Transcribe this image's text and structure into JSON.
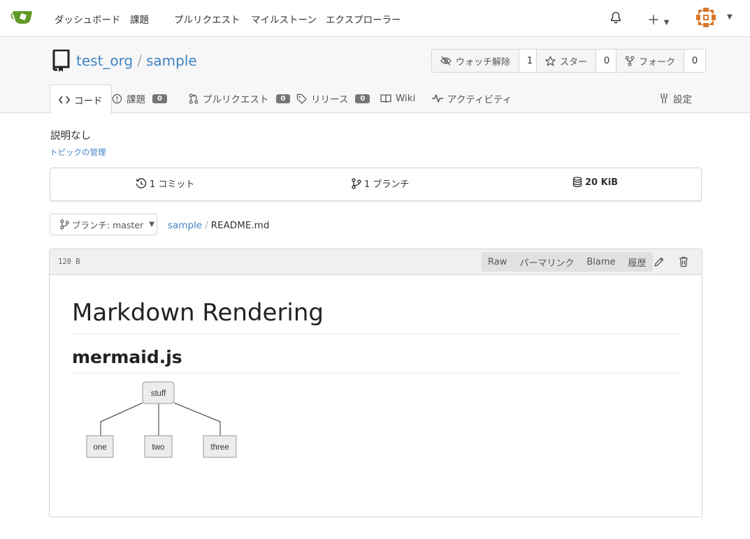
{
  "nav": {
    "items": [
      "ダッシュボード",
      "課題",
      "プルリクエスト",
      "マイルストーン",
      "エクスプローラー"
    ]
  },
  "repo": {
    "owner": "test_org",
    "separator": "/",
    "name": "sample"
  },
  "actions": {
    "watch": {
      "label": "ウォッチ解除",
      "count": "1"
    },
    "star": {
      "label": "スター",
      "count": "0"
    },
    "fork": {
      "label": "フォーク",
      "count": "0"
    }
  },
  "tabs": {
    "code": "コード",
    "issues": {
      "label": "課題",
      "count": "0"
    },
    "pulls": {
      "label": "プルリクエスト",
      "count": "0"
    },
    "releases": {
      "label": "リリース",
      "count": "0"
    },
    "wiki": "Wiki",
    "activity": "アクティビティ",
    "settings": "設定"
  },
  "description": "説明なし",
  "manage_topics": "トピックの管理",
  "stats": {
    "commits": "1 コミット",
    "branches": "1 ブランチ",
    "size": "20 KiB"
  },
  "branch_selector": "ブランチ: master",
  "breadcrumb": {
    "repo": "sample",
    "sep": "/",
    "file": "README.md"
  },
  "file": {
    "size": "120 B",
    "actions": [
      "Raw",
      "パーマリンク",
      "Blame",
      "履歴"
    ]
  },
  "readme": {
    "h1": "Markdown Rendering",
    "h2": "mermaid.js",
    "diagram": {
      "root": "stuff",
      "children": [
        "one",
        "two",
        "three"
      ]
    }
  },
  "colors": {
    "link": "#4183c4",
    "logo": "#609926"
  }
}
